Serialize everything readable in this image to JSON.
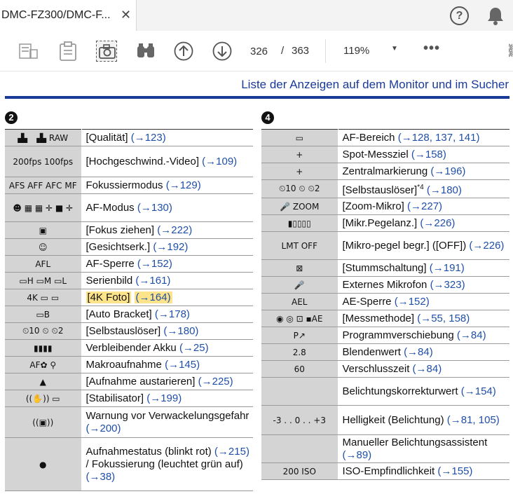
{
  "tab": {
    "title": "DMC-FZ300/DMC-F...",
    "close": "✕"
  },
  "top_right": {
    "help": "?"
  },
  "toolbar": {
    "page_current": "326",
    "page_sep": "/",
    "page_total": "363",
    "zoom": "119%",
    "more": "•••"
  },
  "document": {
    "heading": "Liste der Anzeigen auf dem Monitor und im Sucher",
    "left": {
      "badge": "2",
      "rows": [
        {
          "icon": "▟▖ ▗▙ RAW",
          "text": "[Qualität]",
          "ref": "(→123)",
          "h": 24
        },
        {
          "icon": "200fps 100fps",
          "text": "[Hochgeschwind.-Video]",
          "ref": "(→109)",
          "h": 44
        },
        {
          "icon": "AFS AFF AFC MF",
          "text": "Fokussiermodus",
          "ref": "(→129)",
          "h": 24
        },
        {
          "icon": "☻ ▦ ▦ ✛  ■ ✛",
          "text": "AF-Modus",
          "ref": "(→130)",
          "h": 40
        },
        {
          "icon": "▣",
          "text": "[Fokus ziehen]",
          "ref": "(→222)",
          "h": 24
        },
        {
          "icon": "☺",
          "text": "[Gesichtserk.]",
          "ref": "(→192)",
          "h": 24
        },
        {
          "icon": "AFL",
          "text": "AF-Sperre",
          "ref": "(→152)",
          "h": 24
        },
        {
          "icon": "▭H ▭M ▭L",
          "text": "Serienbild",
          "ref": "(→161)",
          "h": 24
        },
        {
          "icon": "4K ▭ ▭",
          "text": "[4K Foto]",
          "ref": "(→164)",
          "h": 24,
          "highlight": true
        },
        {
          "icon": "▭B",
          "text": "[Auto Bracket]",
          "ref": "(→178)",
          "h": 24
        },
        {
          "icon": "⏲10 ⏲ ⏲2",
          "text": "[Selbstauslöser]",
          "ref": "(→180)",
          "h": 24
        },
        {
          "icon": "▮▮▮▮",
          "text": "Verbleibender Akku",
          "ref": "(→25)",
          "h": 24
        },
        {
          "icon": "AF✿ ⚲",
          "text": "Makroaufnahme",
          "ref": "(→145)",
          "h": 24
        },
        {
          "icon": "▲",
          "text": "[Aufnahme austarieren]",
          "ref": "(→225)",
          "h": 24
        },
        {
          "icon": "((✋)) ▭",
          "text": "[Stabilisator]",
          "ref": "(→199)",
          "h": 24
        },
        {
          "icon": "((▣))",
          "text": "Warnung vor Verwackelungsgefahr",
          "ref": "(→200)",
          "h": 44
        },
        {
          "icon": "●",
          "text": "Aufnahmestatus (blinkt rot)",
          "ref": "(→215)",
          "text2": " / Fokussierung (leuchtet grün auf)",
          "ref2": "(→38)",
          "h": 76
        }
      ]
    },
    "right": {
      "badge": "4",
      "rows": [
        {
          "icon": "▭",
          "text": "AF-Bereich",
          "ref": "(→128, 137, 141)",
          "h": 24
        },
        {
          "icon": "+",
          "text": "Spot-Messziel",
          "ref": "(→158)",
          "h": 24
        },
        {
          "icon": "+",
          "text": "Zentralmarkierung",
          "ref": "(→196)",
          "h": 24
        },
        {
          "icon": "⏲10 ⏲ ⏲2",
          "text": "[Selbstauslöser]",
          "sup": "*4",
          "ref": "(→180)",
          "h": 26
        },
        {
          "icon": "🎤 ZOOM",
          "text": "[Zoom-Mikro]",
          "ref": "(→227)",
          "h": 24
        },
        {
          "icon": "▮▯▯▯▯",
          "text": "[Mikr.Pegelanz.]",
          "ref": "(→226)",
          "h": 24
        },
        {
          "icon": "LMT OFF",
          "text": "[Mikro-pegel begr.] ([OFF])",
          "ref": "(→226)",
          "h": 40
        },
        {
          "icon": "⊠",
          "text": "[Stummschaltung]",
          "ref": "(→191)",
          "h": 24
        },
        {
          "icon": "🎤",
          "text": "Externes Mikrofon",
          "ref": "(→323)",
          "h": 24
        },
        {
          "icon": "AEL",
          "text": "AE-Sperre",
          "ref": "(→152)",
          "h": 24
        },
        {
          "icon": "◉ ◎ ⊡ ▪AE",
          "text": "[Messmethode]",
          "ref": "(→55, 158)",
          "h": 24
        },
        {
          "icon": "P↗",
          "text": "Programmverschiebung",
          "ref": "(→84)",
          "h": 24
        },
        {
          "icon": "2.8",
          "text": "Blendenwert",
          "ref": "(→84)",
          "h": 24
        },
        {
          "icon": "60",
          "text": "Verschlusszeit",
          "ref": "(→84)",
          "h": 24
        },
        {
          "icon": "",
          "text": "Belichtungskorrekturwert",
          "ref": "(→154)",
          "h": 40
        },
        {
          "icon": "-3 . . 0 . . +3",
          "text": "Helligkeit (Belichtung)",
          "ref": "(→81, 105)",
          "h": 42
        },
        {
          "icon": "",
          "text": "Manueller Belichtungsassistent",
          "ref": "(→89)",
          "h": 40
        },
        {
          "icon": "200 ISO",
          "text": "ISO-Empfindlichkeit",
          "ref": "(→155)",
          "h": 24
        }
      ]
    }
  }
}
